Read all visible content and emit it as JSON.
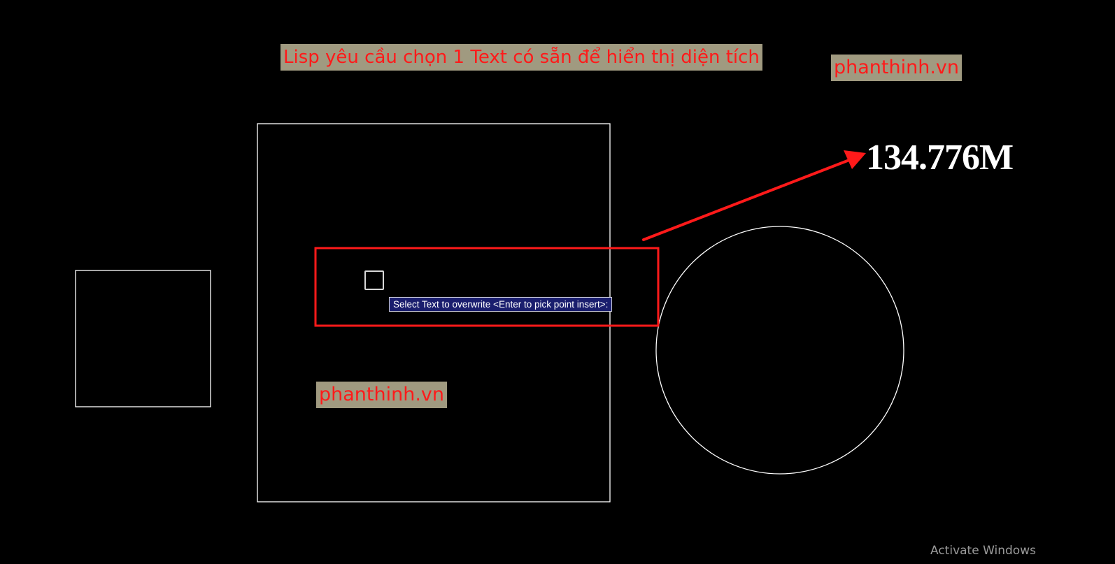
{
  "caption": {
    "text": "Lisp yêu cầu chọn 1 Text có sẵn để hiển thị diện tích"
  },
  "watermarks": {
    "top": "phanthinh.vn",
    "middle": "phanthinh.vn"
  },
  "area_value": "134.776M",
  "command_prompt": {
    "text": "Select Text to overwrite <Enter to pick point insert>:"
  },
  "os_notice": "Activate Windows",
  "colors": {
    "background": "#000000",
    "highlight": "#ff1a1a",
    "caption_bg": "#a09a80",
    "geometry": "#ffffff",
    "tooltip_bg": "#1a1e6e"
  },
  "icons": {
    "cursor": "pickbox-cursor-icon",
    "arrow": "arrow-icon"
  }
}
